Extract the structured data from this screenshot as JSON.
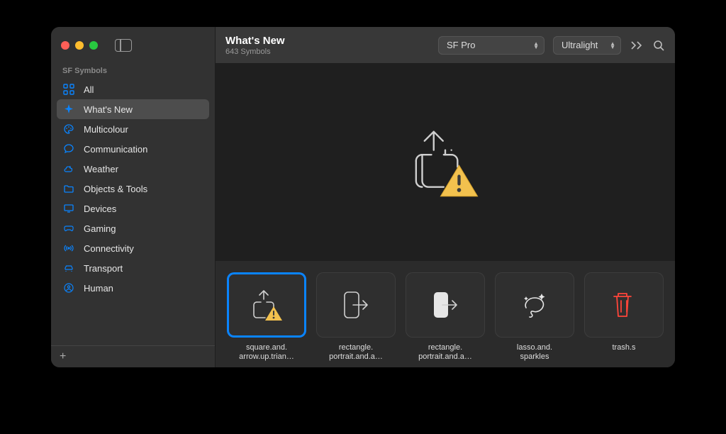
{
  "sidebar": {
    "heading": "SF Symbols",
    "items": [
      {
        "label": "All"
      },
      {
        "label": "What's New"
      },
      {
        "label": "Multicolour"
      },
      {
        "label": "Communication"
      },
      {
        "label": "Weather"
      },
      {
        "label": "Objects & Tools"
      },
      {
        "label": "Devices"
      },
      {
        "label": "Gaming"
      },
      {
        "label": "Connectivity"
      },
      {
        "label": "Transport"
      },
      {
        "label": "Human"
      }
    ],
    "selected_index": 1,
    "footer_add": "+"
  },
  "toolbar": {
    "title": "What's New",
    "subtitle": "643 Symbols",
    "font_popup": "SF Pro",
    "weight_popup": "Ultralight"
  },
  "grid": {
    "selected_index": 0,
    "cells": [
      {
        "caption": "square.and.\narrow.up.trian…"
      },
      {
        "caption": "rectangle.\nportrait.and.a…"
      },
      {
        "caption": "rectangle.\nportrait.and.a…"
      },
      {
        "caption": "lasso.and.\nsparkles"
      },
      {
        "caption": "trash.s"
      }
    ]
  },
  "colors": {
    "accent": "#0a84ff",
    "warn": "#f2c14e"
  }
}
